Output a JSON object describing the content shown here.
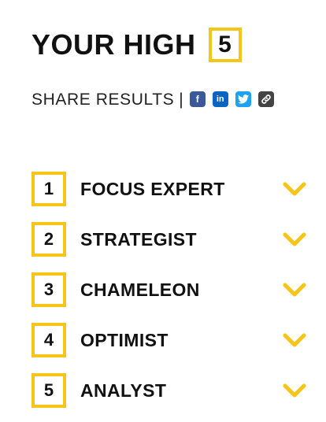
{
  "heading": {
    "title": "YOUR HIGH",
    "count": "5"
  },
  "share": {
    "label": "SHARE RESULTS",
    "separator": "|",
    "icons": [
      {
        "name": "facebook-icon",
        "glyph": "f"
      },
      {
        "name": "linkedin-icon",
        "glyph": "in"
      },
      {
        "name": "twitter-icon",
        "glyph": "t"
      },
      {
        "name": "link-icon",
        "glyph": "⛓"
      }
    ]
  },
  "results": [
    {
      "rank": "1",
      "label": "FOCUS EXPERT"
    },
    {
      "rank": "2",
      "label": "STRATEGIST"
    },
    {
      "rank": "3",
      "label": "CHAMELEON"
    },
    {
      "rank": "4",
      "label": "OPTIMIST"
    },
    {
      "rank": "5",
      "label": "ANALYST"
    }
  ],
  "colors": {
    "accent": "#f5c518",
    "text": "#111111",
    "facebook": "#3b5998",
    "linkedin": "#0a66c2",
    "twitter": "#1da1f2",
    "link": "#444444"
  }
}
